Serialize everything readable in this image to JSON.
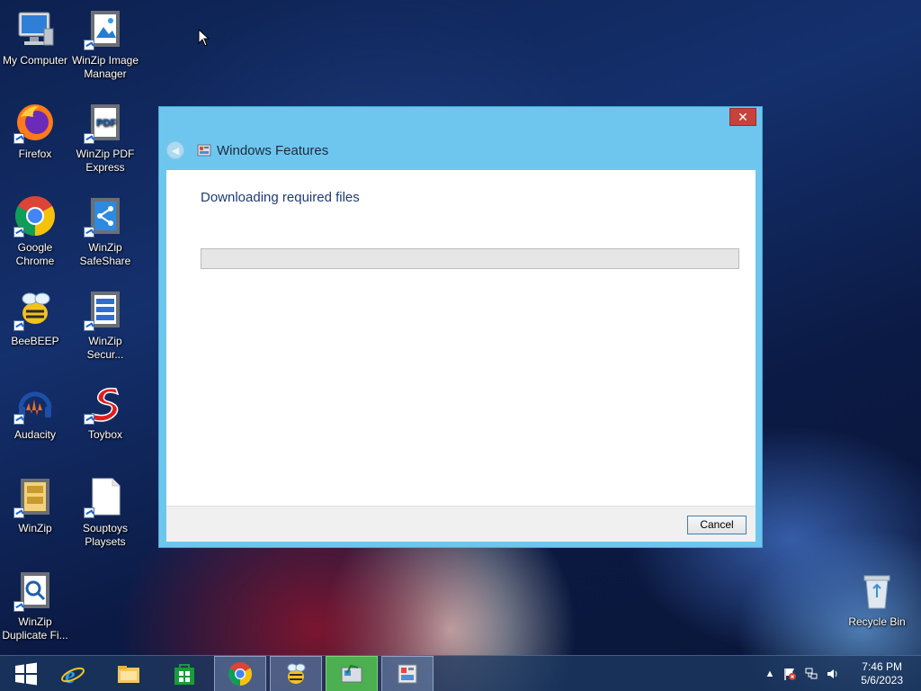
{
  "desktop": {
    "icons": [
      {
        "label": "My Computer"
      },
      {
        "label": "WinZip Image Manager"
      },
      {
        "label": "Firefox"
      },
      {
        "label": "WinZip PDF Express"
      },
      {
        "label": "Google Chrome"
      },
      {
        "label": "WinZip SafeShare"
      },
      {
        "label": "BeeBEEP"
      },
      {
        "label": "WinZip Secur..."
      },
      {
        "label": "Audacity"
      },
      {
        "label": "Toybox"
      },
      {
        "label": "WinZip"
      },
      {
        "label": "Souptoys Playsets"
      },
      {
        "label": "WinZip Duplicate Fi..."
      },
      {
        "label": "Recycle Bin"
      }
    ]
  },
  "dialog": {
    "title": "Windows Features",
    "close_label": "✕",
    "heading": "Downloading required files",
    "progress_fraction": 0,
    "cancel_label": "Cancel"
  },
  "taskbar": {
    "items": [
      "start-icon",
      "internet-explorer-icon",
      "file-explorer-icon",
      "store-icon",
      "chrome-icon",
      "beebeep-icon",
      "windows-features-icon",
      "control-panel-icon"
    ],
    "clock": {
      "time": "7:46 PM",
      "date": "5/6/2023"
    }
  },
  "colors": {
    "dialog_frame": "#6ec6ef",
    "close_button": "#c7423a",
    "heading_text": "#1e3a78",
    "taskbar": "#1c3860"
  }
}
